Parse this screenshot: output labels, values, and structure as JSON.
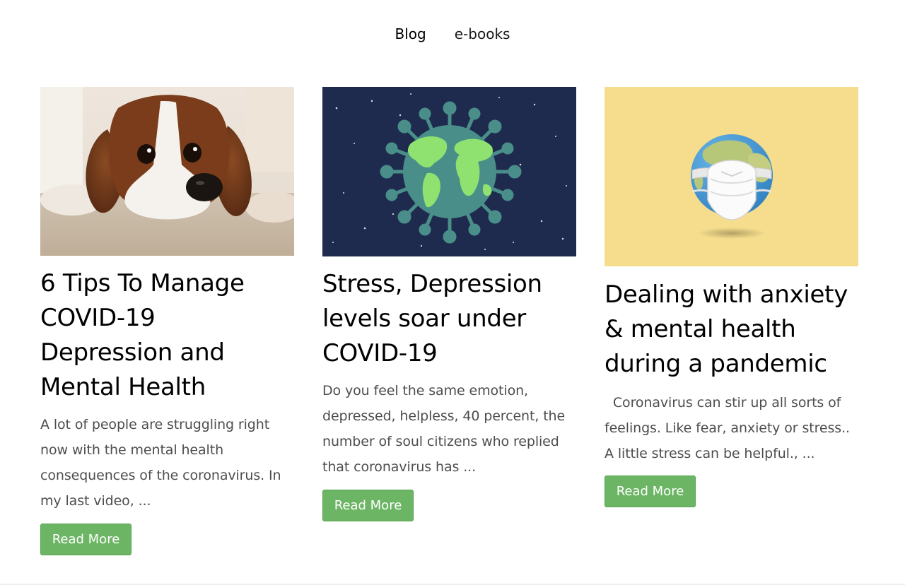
{
  "nav": {
    "items": [
      {
        "label": "Blog"
      },
      {
        "label": "e-books"
      }
    ]
  },
  "posts": [
    {
      "title": "6 Tips To Manage COVID-19 Depression and Mental Health",
      "excerpt": "A lot of people are struggling right now with the mental health consequences of the coronavirus. In my last video, ...",
      "button": "Read More",
      "image": "dog-photo"
    },
    {
      "title": "Stress, Depression levels soar under COVID-19",
      "excerpt": "Do you feel the same emotion, depressed, helpless, 40 percent, the number of soul citizens who replied that coronavirus has ...",
      "button": "Read More",
      "image": "virus-globe-illustration"
    },
    {
      "title": "Dealing with anxiety & mental health during a pandemic",
      "excerpt": "Coronavirus can stir up all sorts of feelings. Like fear, anxiety or stress.. A little stress can be helpful., ...",
      "button": "Read More",
      "image": "globe-with-mask-illustration"
    }
  ],
  "colors": {
    "button_bg": "#6cb564",
    "virus_bg": "#1f2a4f",
    "mask_bg": "#f5dd8d"
  }
}
